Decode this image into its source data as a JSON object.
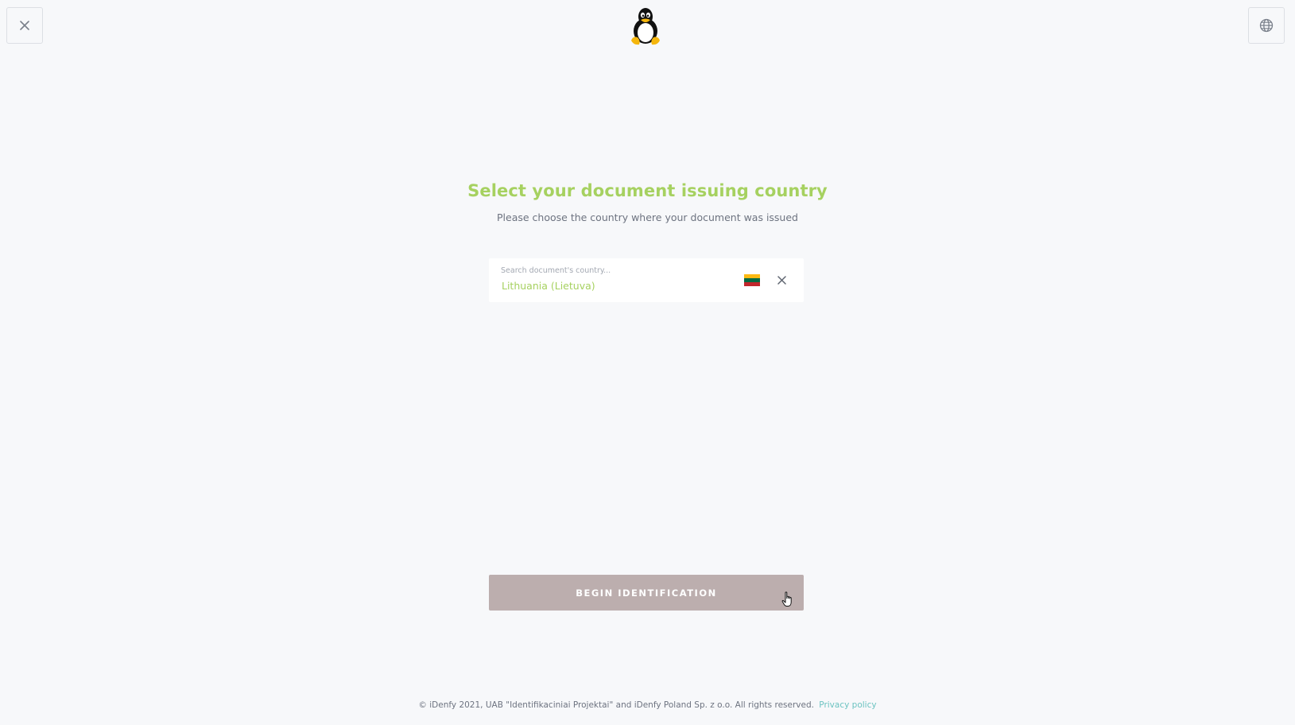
{
  "header": {
    "close_icon": "close-icon",
    "language_icon": "globe-icon",
    "logo_icon": "tux-penguin-logo"
  },
  "main": {
    "title": "Select your document issuing country",
    "subtitle": "Please choose the country where your document was issued"
  },
  "country_select": {
    "label": "Search document's country...",
    "value": "Lithuania (Lietuva)",
    "flag_icon": "lithuania-flag-icon",
    "flag_colors": [
      "#fdb913",
      "#006a44",
      "#c1272d"
    ],
    "clear_icon": "close-icon"
  },
  "actions": {
    "begin_label": "BEGIN IDENTIFICATION"
  },
  "footer": {
    "copyright": "© iDenfy 2021, UAB \"Identifikaciniai Projektai\" and iDenfy Poland Sp. z o.o. All rights reserved.",
    "privacy_link": "Privacy policy"
  },
  "colors": {
    "accent": "#a6d160",
    "button_bg": "#bcaeae",
    "link": "#6cc3c1",
    "background": "#f7f8fa"
  }
}
